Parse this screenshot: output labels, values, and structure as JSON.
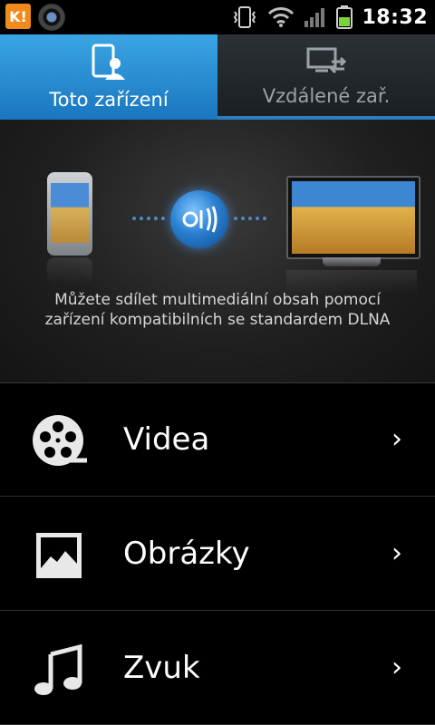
{
  "status_bar": {
    "app_badge": "K!",
    "time": "18:32",
    "icons": [
      "k-app-icon",
      "camera-icon",
      "vibrate-icon",
      "wifi-icon",
      "signal-icon",
      "battery-icon"
    ]
  },
  "tabs": [
    {
      "label": "Toto zařízení",
      "icon": "device-user-icon",
      "active": true
    },
    {
      "label": "Vzdálené zař.",
      "icon": "remote-screens-icon",
      "active": false
    }
  ],
  "hero": {
    "description": "Můžete sdílet multimediální obsah pomocí zařízení kompatibilních se standardem DLNA",
    "illustration": [
      "phone-icon",
      "dlna-icon",
      "tv-icon"
    ]
  },
  "menu": [
    {
      "label": "Videa",
      "icon": "film-reel-icon"
    },
    {
      "label": "Obrázky",
      "icon": "picture-icon"
    },
    {
      "label": "Zvuk",
      "icon": "music-note-icon"
    }
  ],
  "colors": {
    "accent": "#2f94da",
    "tab_inactive": "#22272b",
    "background": "#000000"
  }
}
